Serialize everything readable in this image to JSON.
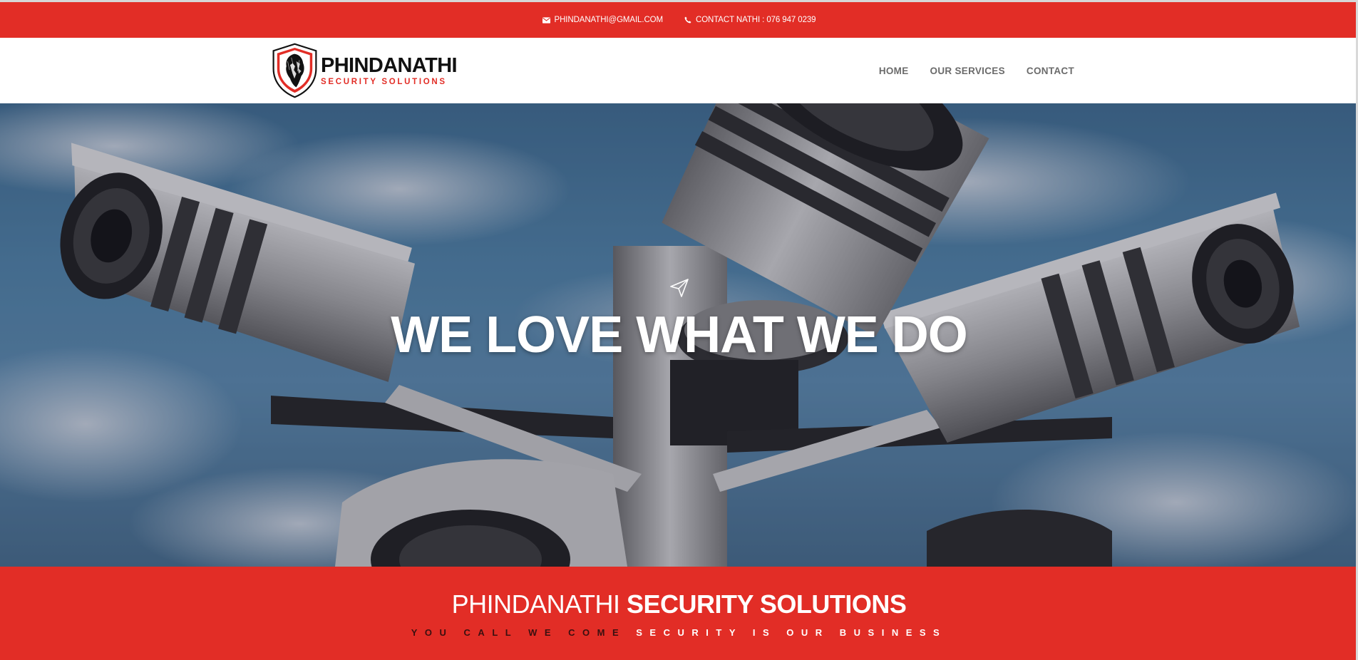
{
  "topbar": {
    "email": "PHINDANATHI@GMAIL.COM",
    "email_icon": "envelope-icon",
    "phone": "CONTACT NATHI : 076 947 0239",
    "phone_icon": "phone-icon"
  },
  "logo": {
    "name": "PHINDANATHI",
    "tagline": "SECURITY SOLUTIONS",
    "emblem_icon": "lion-shield-icon"
  },
  "nav": {
    "items": [
      "HOME",
      "OUR SERVICES",
      "CONTACT"
    ]
  },
  "hero": {
    "icon": "paper-plane-icon",
    "heading": "WE LOVE WHAT WE DO"
  },
  "banner": {
    "title_light": "PHINDANATHI",
    "title_bold": "SECURITY SOLUTIONS",
    "subtitle_dark": "YOU CALL WE COME",
    "subtitle_light": "SECURITY IS OUR BUSINESS"
  },
  "colors": {
    "brand_red": "#e22d26",
    "nav_text": "#6b6b6b"
  }
}
